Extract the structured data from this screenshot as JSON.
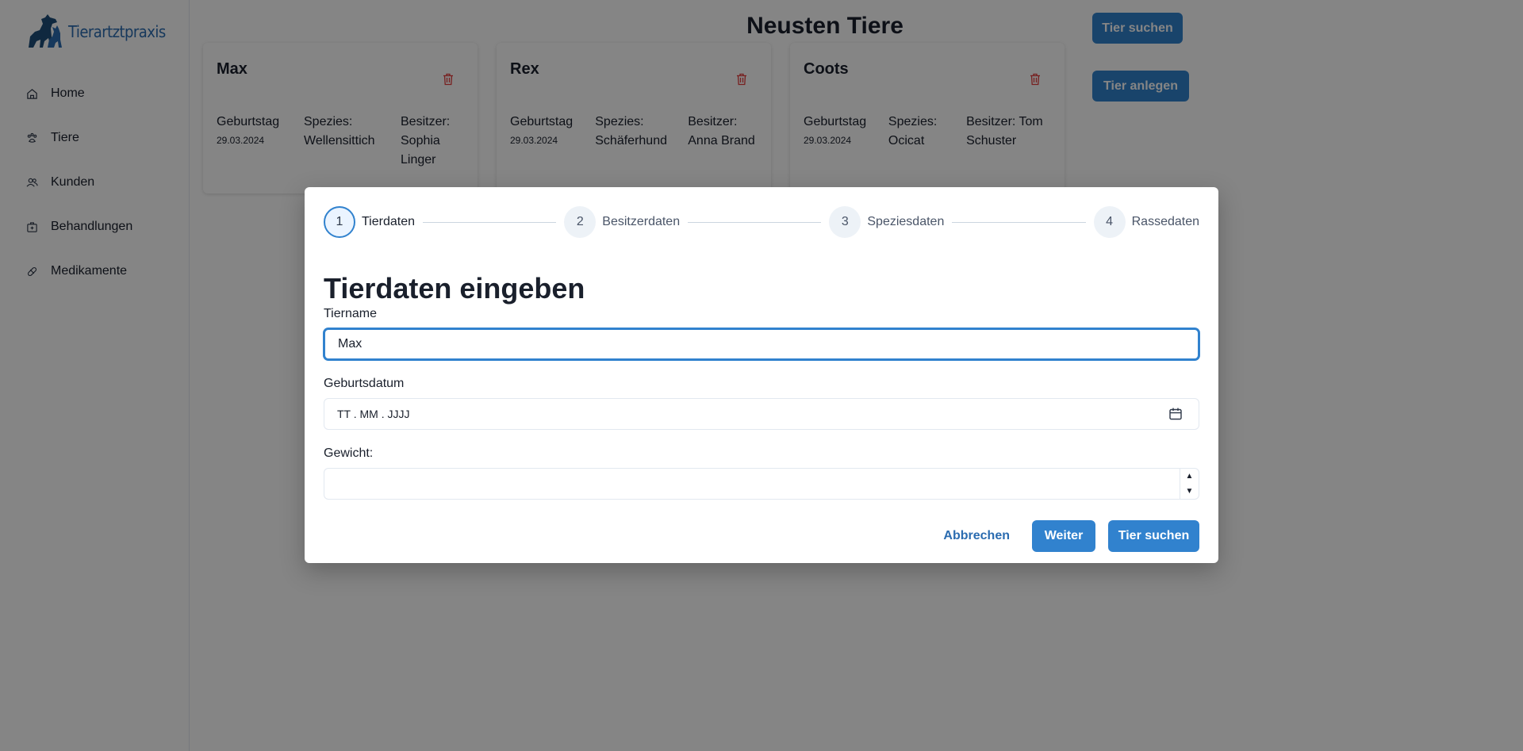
{
  "app": {
    "name": "Tierartztpraxis"
  },
  "sidebar": {
    "items": [
      {
        "label": "Home",
        "icon": "home-icon"
      },
      {
        "label": "Tiere",
        "icon": "paw-icon"
      },
      {
        "label": "Kunden",
        "icon": "users-icon"
      },
      {
        "label": "Behandlungen",
        "icon": "medical-kit-icon"
      },
      {
        "label": "Medikamente",
        "icon": "pill-icon"
      }
    ]
  },
  "header": {
    "title": "Neusten Tiere",
    "search_button": "Tier suchen",
    "create_button": "Tier anlegen"
  },
  "cards": [
    {
      "name": "Max",
      "birthday_label": "Geburtstag",
      "birthday": "29.03.2024",
      "species_label": "Spezies:",
      "species": "Wellensittich",
      "owner": "Besitzer: Sophia Linger"
    },
    {
      "name": "Rex",
      "birthday_label": "Geburtstag",
      "birthday": "29.03.2024",
      "species_label": "Spezies:",
      "species": "Schäferhund",
      "owner": "Besitzer: Anna Brand"
    },
    {
      "name": "Coots",
      "birthday_label": "Geburtstag",
      "birthday": "29.03.2024",
      "species_label": "Spezies:",
      "species": "Ocicat",
      "owner": "Besitzer: Tom Schuster"
    }
  ],
  "modal": {
    "steps": [
      {
        "num": "1",
        "label": "Tierdaten",
        "active": true
      },
      {
        "num": "2",
        "label": "Besitzerdaten",
        "active": false
      },
      {
        "num": "3",
        "label": "Speziesdaten",
        "active": false
      },
      {
        "num": "4",
        "label": "Rassedaten",
        "active": false
      }
    ],
    "title": "Tierdaten eingeben",
    "fields": {
      "name_label": "Tiername",
      "name_value": "Max",
      "birthdate_label": "Geburtsdatum",
      "birthdate_placeholder": "TT . MM . JJJJ",
      "weight_label": "Gewicht:",
      "weight_value": ""
    },
    "buttons": {
      "cancel": "Abbrechen",
      "next": "Weiter",
      "search": "Tier suchen"
    }
  },
  "colors": {
    "accent": "#3182ce",
    "brand": "#2b6cb0",
    "danger": "#e53e3e",
    "overlay": "rgba(0,0,0,0.48)"
  }
}
